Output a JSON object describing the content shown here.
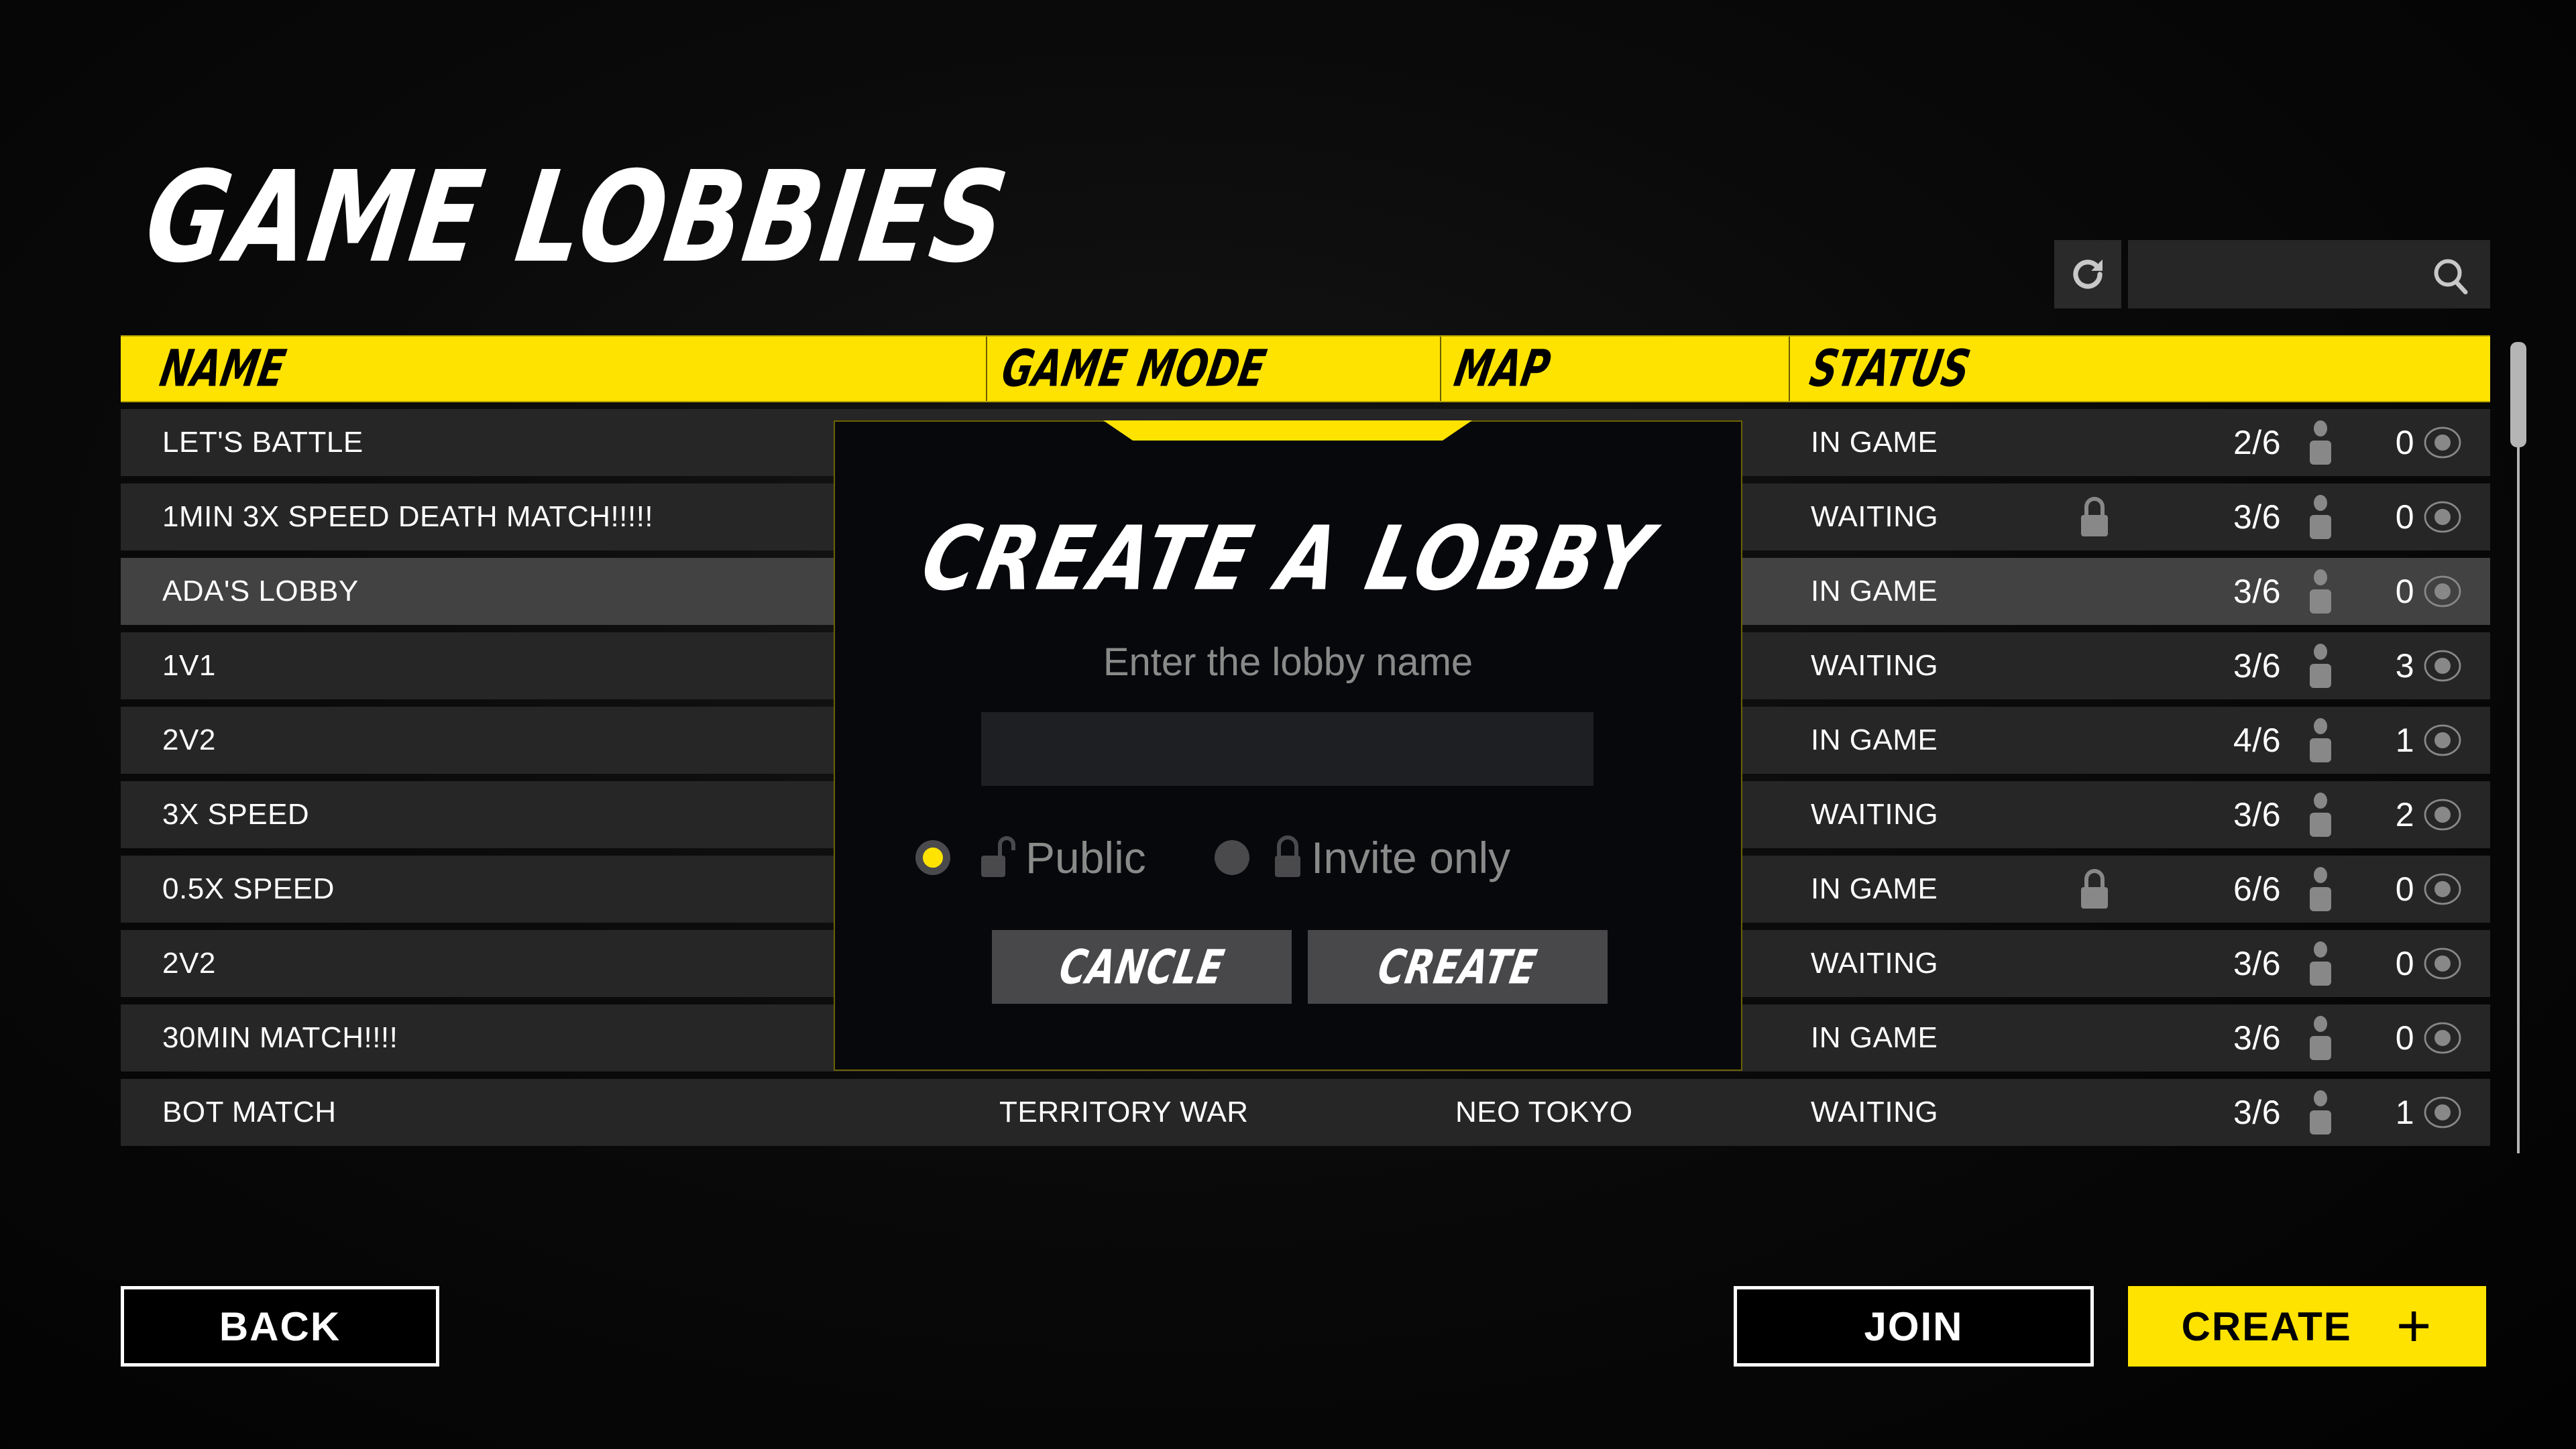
{
  "page": {
    "title": "GAME LOBBIES"
  },
  "toolbar": {
    "refresh_icon": "refresh-icon",
    "search_icon": "search-icon",
    "search_value": "",
    "search_placeholder": ""
  },
  "table": {
    "headers": [
      "NAME",
      "GAME MODE",
      "MAP",
      "STATUS"
    ],
    "rows": [
      {
        "name": "LET'S BATTLE",
        "mode": "",
        "map": "",
        "status": "IN GAME",
        "locked": false,
        "players": "2/6",
        "spectators": "0"
      },
      {
        "name": "1MIN 3X SPEED DEATH MATCH!!!!!",
        "mode": "",
        "map": "",
        "status": "WAITING",
        "locked": true,
        "players": "3/6",
        "spectators": "0"
      },
      {
        "name": "ADA'S LOBBY",
        "mode": "",
        "map": "",
        "status": "IN GAME",
        "locked": false,
        "players": "3/6",
        "spectators": "0",
        "selected": true
      },
      {
        "name": "1V1",
        "mode": "",
        "map": "",
        "status": "WAITING",
        "locked": false,
        "players": "3/6",
        "spectators": "3"
      },
      {
        "name": "2V2",
        "mode": "",
        "map": "",
        "status": "IN GAME",
        "locked": false,
        "players": "4/6",
        "spectators": "1"
      },
      {
        "name": "3X SPEED",
        "mode": "",
        "map": "",
        "status": "WAITING",
        "locked": false,
        "players": "3/6",
        "spectators": "2"
      },
      {
        "name": "0.5X SPEED",
        "mode": "",
        "map": "",
        "status": "IN GAME",
        "locked": true,
        "players": "6/6",
        "spectators": "0"
      },
      {
        "name": "2V2",
        "mode": "",
        "map": "",
        "status": "WAITING",
        "locked": false,
        "players": "3/6",
        "spectators": "0"
      },
      {
        "name": "30MIN MATCH!!!!",
        "mode": "",
        "map": "",
        "status": "IN GAME",
        "locked": false,
        "players": "3/6",
        "spectators": "0"
      },
      {
        "name": "BOT MATCH",
        "mode": "TERRITORY WAR",
        "map": "NEO TOKYO",
        "status": "WAITING",
        "locked": false,
        "players": "3/6",
        "spectators": "1"
      }
    ]
  },
  "scrollbar": {
    "position_fraction": 0.0,
    "visible_fraction": 0.13
  },
  "modal": {
    "title": "CREATE A LOBBY",
    "label": "Enter the lobby name",
    "input_value": "",
    "options": [
      {
        "label": "Public",
        "icon": "unlocked-icon",
        "selected": true
      },
      {
        "label": "Invite only",
        "icon": "lock-icon",
        "selected": false
      }
    ],
    "cancel_label": "CANCLE",
    "create_label": "CREATE"
  },
  "footer": {
    "back_label": "BACK",
    "join_label": "JOIN",
    "create_label": "CREATE",
    "create_icon": "plus-icon"
  },
  "colors": {
    "accent": "#ffe300",
    "row_bg": "#282828",
    "row_selected_bg": "#444444",
    "modal_bg": "#07080b",
    "icon_gray": "#888888"
  }
}
